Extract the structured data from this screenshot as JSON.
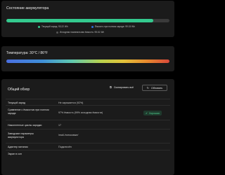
{
  "battery": {
    "title": "Состояние аккумулятора",
    "charge_fraction": 0.9,
    "legend": [
      {
        "label": "Текущий заряд: 93.22 Wh",
        "color": "#34c98e"
      },
      {
        "label": "Ёмкость при полном заряде: 99.15 Wh",
        "color": "#2b6fd6"
      },
      {
        "label": "Исходная номинальная ёмкость: 95.61 Wh",
        "color": "#555555"
      }
    ]
  },
  "temperature": {
    "title": "Температура: 30°C / 86°F"
  },
  "overview": {
    "title": "Общий обзор",
    "copy_label": "Скопировать всё",
    "refresh_label": "Обновить",
    "good_label": "Хорошая",
    "rows": [
      {
        "key": "Текущий заряд",
        "value": "Не заряжается (92%)"
      },
      {
        "key": "Сравнение с ёмкостью при полном заряде",
        "value": "97% ёмкость (99% исходная ёмкости)"
      },
      {
        "key": "Накопленные циклы зарядки",
        "value": "17"
      },
      {
        "key": "Заводские параметры аккумулятора",
        "value": "/mail-/потоковые/"
      },
      {
        "key": "Адаптер питания",
        "value": "Подключён"
      },
      {
        "key": "Экран в сон",
        "value": ""
      }
    ]
  },
  "colors": {
    "card_bg": "#1b1b1b",
    "charge_green": "#34c98e",
    "good_badge_bg": "#1f3a2d"
  }
}
